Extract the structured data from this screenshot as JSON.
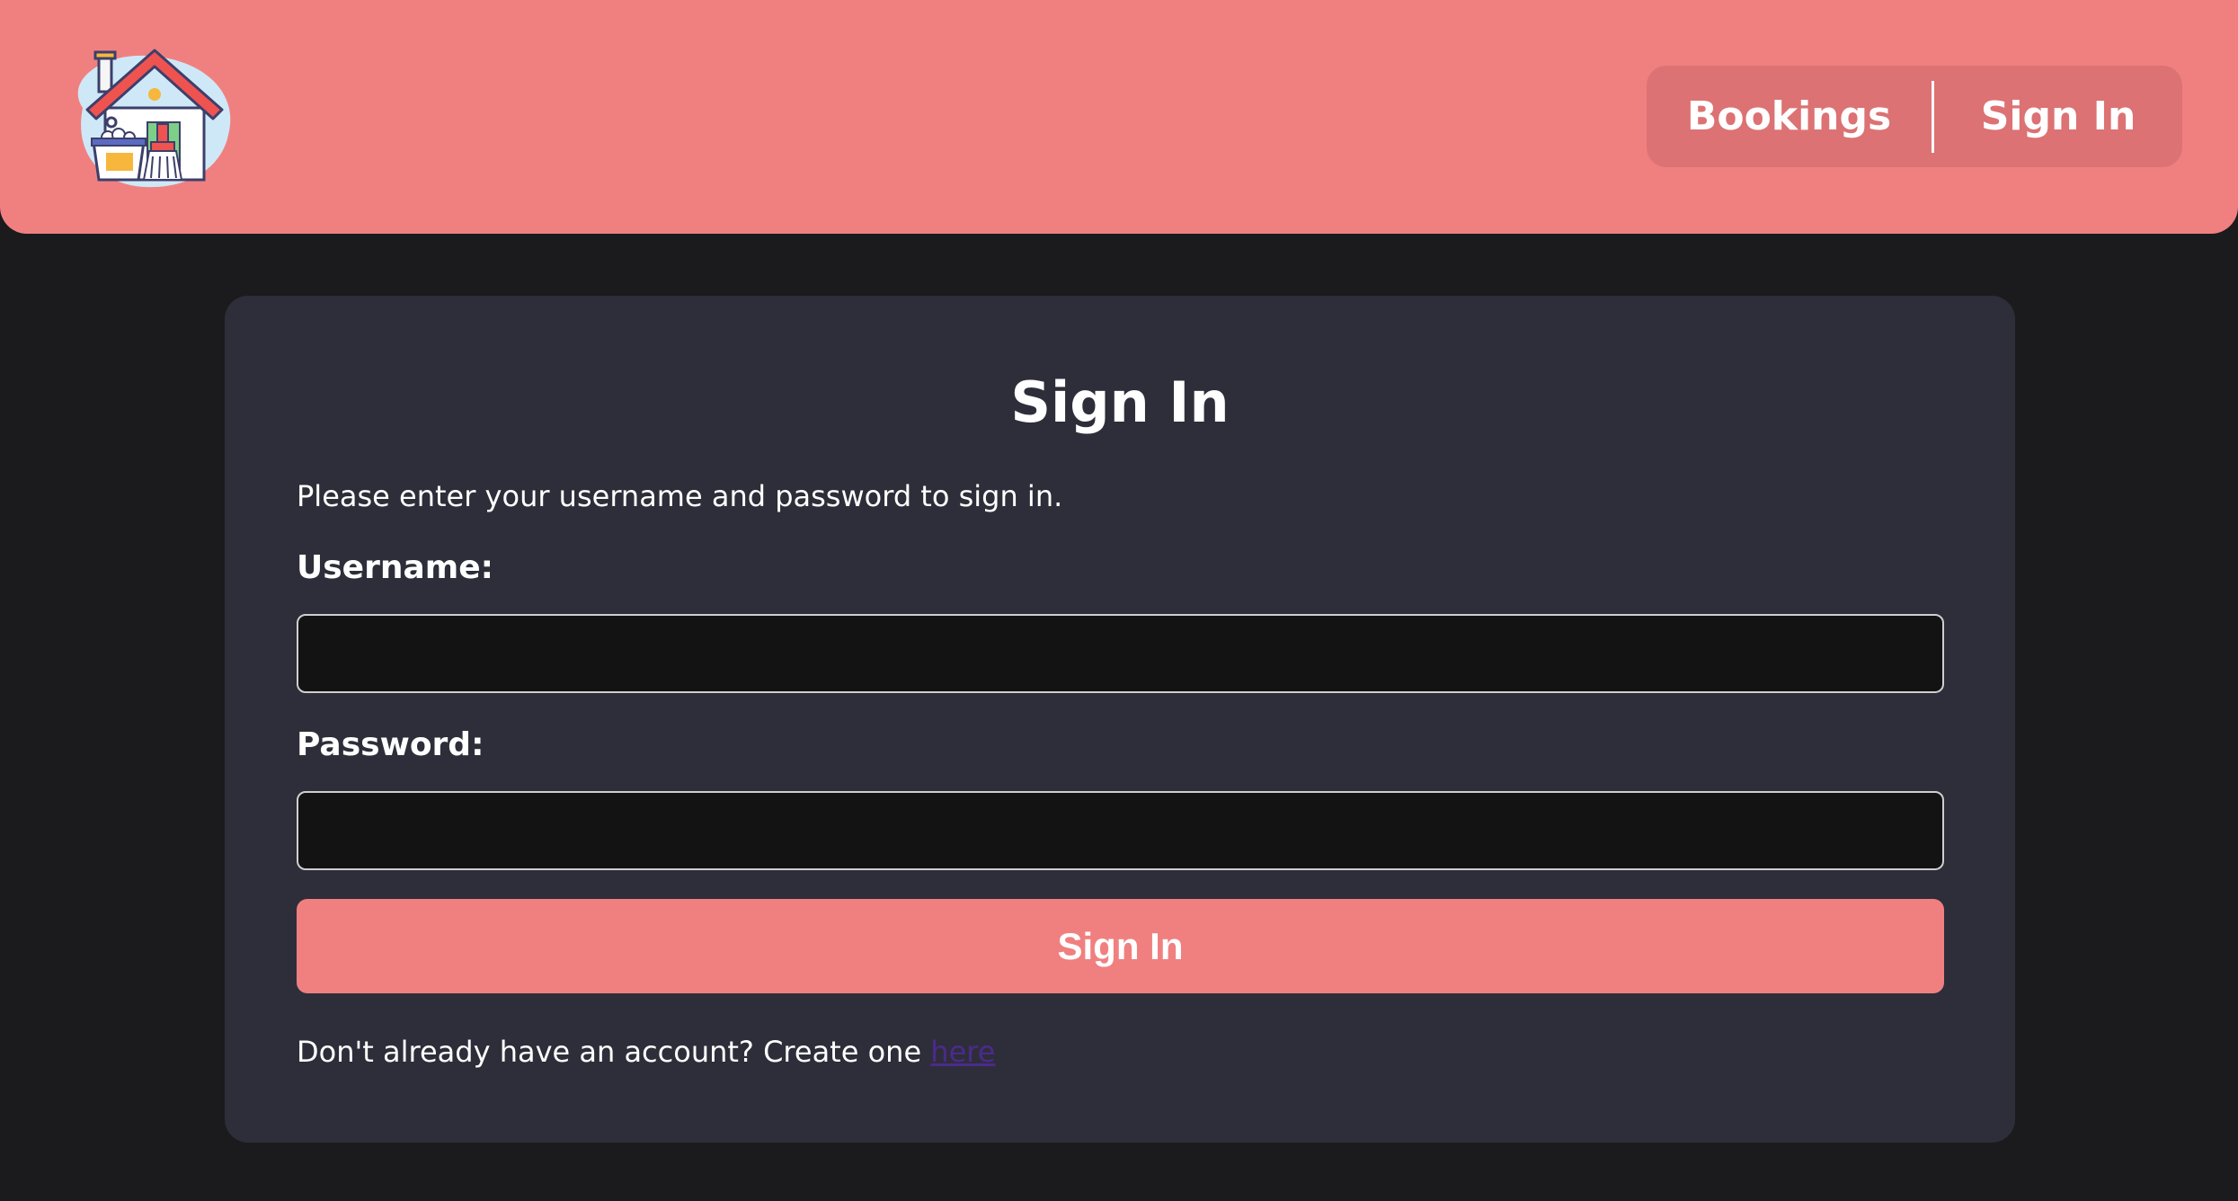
{
  "header": {
    "logo_icon": "house-cleaning-logo-icon",
    "brand_color": "#f08080",
    "nav": {
      "bookings_label": "Bookings",
      "signin_label": "Sign In"
    }
  },
  "signin_form": {
    "title": "Sign In",
    "instructions": "Please enter your username and password to sign in.",
    "username_label": "Username:",
    "username_value": "",
    "password_label": "Password:",
    "password_value": "",
    "submit_label": "Sign In",
    "footer_text": "Don't already have an account? Create one",
    "footer_link": "here"
  }
}
